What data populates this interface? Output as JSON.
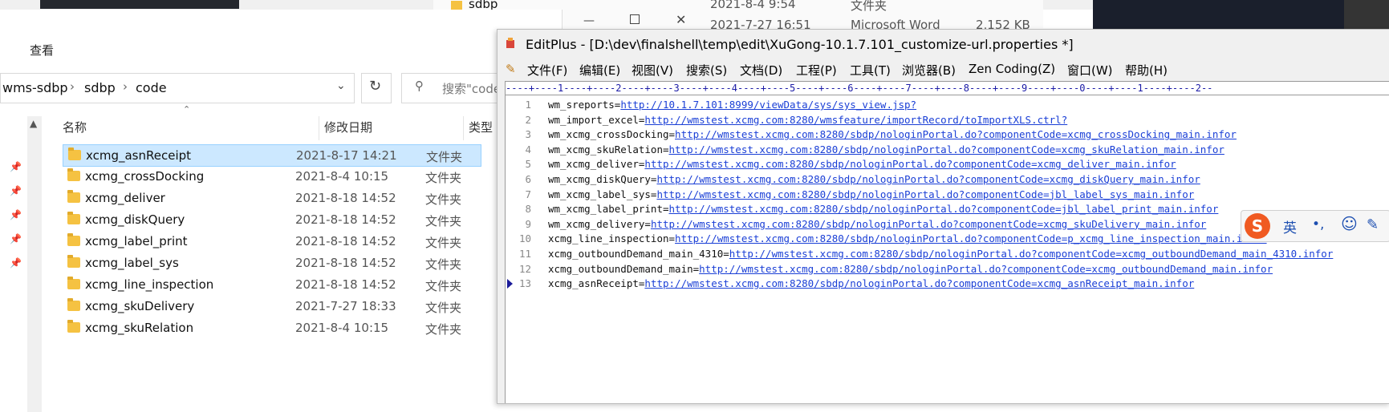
{
  "background": {
    "folder_name": "sdbp",
    "folder_date": "2021-8-4 9:54",
    "folder_type": "文件夹",
    "file_date": "2021-7-27 16:51",
    "file_type": "Microsoft Word",
    "file_size": "2,152 KB"
  },
  "explorer": {
    "ribbon_tab": "查看",
    "breadcrumb": [
      "wms-sdbp",
      "sdbp",
      "code"
    ],
    "search_placeholder": "搜索\"code",
    "columns": {
      "name": "名称",
      "date": "修改日期",
      "type": "类型"
    },
    "rows": [
      {
        "name": "xcmg_asnReceipt",
        "date": "2021-8-17 14:21",
        "type": "文件夹",
        "selected": true
      },
      {
        "name": "xcmg_crossDocking",
        "date": "2021-8-4 10:15",
        "type": "文件夹",
        "selected": false
      },
      {
        "name": "xcmg_deliver",
        "date": "2021-8-18 14:52",
        "type": "文件夹",
        "selected": false
      },
      {
        "name": "xcmg_diskQuery",
        "date": "2021-8-18 14:52",
        "type": "文件夹",
        "selected": false
      },
      {
        "name": "xcmg_label_print",
        "date": "2021-8-18 14:52",
        "type": "文件夹",
        "selected": false
      },
      {
        "name": "xcmg_label_sys",
        "date": "2021-8-18 14:52",
        "type": "文件夹",
        "selected": false
      },
      {
        "name": "xcmg_line_inspection",
        "date": "2021-8-18 14:52",
        "type": "文件夹",
        "selected": false
      },
      {
        "name": "xcmg_skuDelivery",
        "date": "2021-7-27 18:33",
        "type": "文件夹",
        "selected": false
      },
      {
        "name": "xcmg_skuRelation",
        "date": "2021-8-4 10:15",
        "type": "文件夹",
        "selected": false
      }
    ]
  },
  "editplus": {
    "title": "EditPlus - [D:\\dev\\finalshell\\temp\\edit\\XuGong-10.1.7.101_customize-url.properties *]",
    "menu": [
      "文件(F)",
      "编辑(E)",
      "视图(V)",
      "搜索(S)",
      "文档(D)",
      "工程(P)",
      "工具(T)",
      "浏览器(B)",
      "Zen Coding(Z)",
      "窗口(W)",
      "帮助(H)"
    ],
    "ruler": "----+----1----+----2----+----3----+----4----+----5----+----6----+----7----+----8----+----9----+----0----+----1----+----2--",
    "current_line": 13,
    "lines": [
      {
        "n": "1",
        "key": "wm_sreports=",
        "url": "http://10.1.7.101:8999/viewData/sys/sys_view.jsp?"
      },
      {
        "n": "2",
        "key": "wm_import_excel=",
        "url": "http://wmstest.xcmg.com:8280/wmsfeature/importRecord/toImportXLS.ctrl?"
      },
      {
        "n": "3",
        "key": "wm_xcmg_crossDocking=",
        "url": "http://wmstest.xcmg.com:8280/sbdp/nologinPortal.do?componentCode=xcmg_crossDocking_main.infor"
      },
      {
        "n": "4",
        "key": "wm_xcmg_skuRelation=",
        "url": "http://wmstest.xcmg.com:8280/sbdp/nologinPortal.do?componentCode=xcmg_skuRelation_main.infor"
      },
      {
        "n": "5",
        "key": "wm_xcmg_deliver=",
        "url": "http://wmstest.xcmg.com:8280/sbdp/nologinPortal.do?componentCode=xcmg_deliver_main.infor"
      },
      {
        "n": "6",
        "key": "wm_xcmg_diskQuery=",
        "url": "http://wmstest.xcmg.com:8280/sbdp/nologinPortal.do?componentCode=xcmg_diskQuery_main.infor"
      },
      {
        "n": "7",
        "key": "wm_xcmg_label_sys=",
        "url": "http://wmstest.xcmg.com:8280/sbdp/nologinPortal.do?componentCode=jbl_label_sys_main.infor"
      },
      {
        "n": "8",
        "key": "wm_xcmg_label_print=",
        "url": "http://wmstest.xcmg.com:8280/sbdp/nologinPortal.do?componentCode=jbl_label_print_main.infor"
      },
      {
        "n": "9",
        "key": "wm_xcmg_delivery=",
        "url": "http://wmstest.xcmg.com:8280/sbdp/nologinPortal.do?componentCode=xcmg_skuDelivery_main.infor"
      },
      {
        "n": "10",
        "key": "xcmg_line_inspection=",
        "url": "http://wmstest.xcmg.com:8280/sbdp/nologinPortal.do?componentCode=p_xcmg_line_inspection_main.infor"
      },
      {
        "n": "11",
        "key": "xcmg_outboundDemand_main_4310=",
        "url": "http://wmstest.xcmg.com:8280/sbdp/nologinPortal.do?componentCode=xcmg_outboundDemand_main_4310.infor"
      },
      {
        "n": "12",
        "key": "xcmg_outboundDemand_main=",
        "url": "http://wmstest.xcmg.com:8280/sbdp/nologinPortal.do?componentCode=xcmg_outboundDemand_main.infor"
      },
      {
        "n": "13",
        "key": "xcmg_asnReceipt=",
        "url": "http://wmstest.xcmg.com:8280/sbdp/nologinPortal.do?componentCode=xcmg_asnReceipt_main.infor"
      }
    ]
  },
  "ime": {
    "logo": "S",
    "lang": "英",
    "punct": "•,",
    "emoji": "☺",
    "tool": "✎"
  },
  "colors": {
    "selection": "#cce8ff",
    "link": "#1a3fd6",
    "ime_orange": "#f05a22"
  }
}
